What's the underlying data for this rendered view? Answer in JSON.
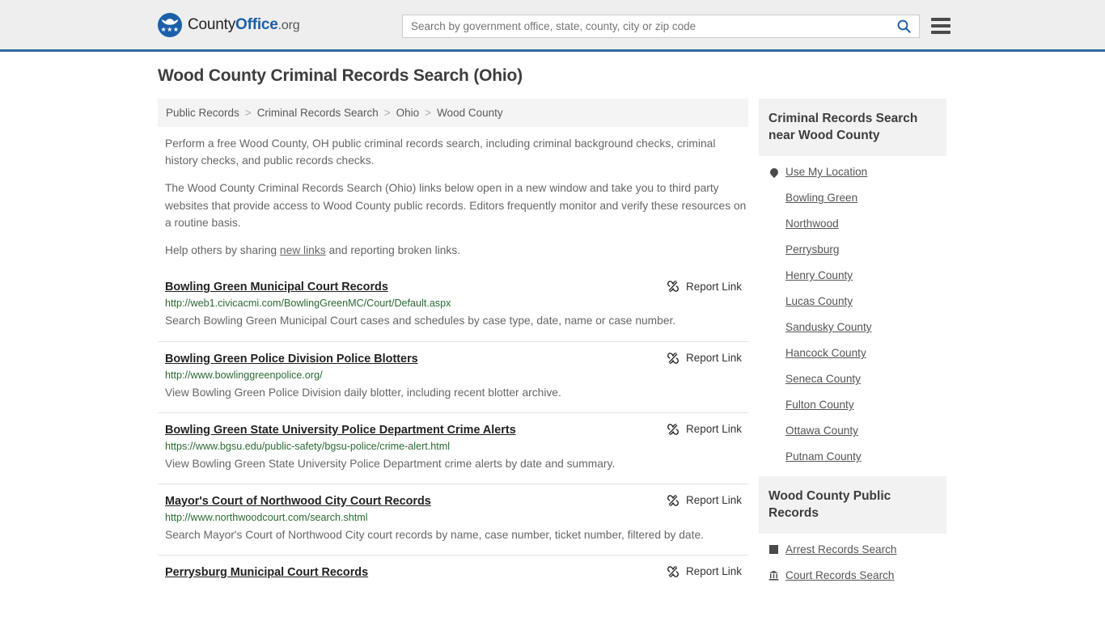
{
  "header": {
    "logo": {
      "prefix": "County",
      "bold": "Office",
      "tld": ".org",
      "badge_icon": "eagle-shield-icon"
    },
    "search": {
      "placeholder": "Search by government office, state, county, city or zip code",
      "value": "",
      "button_icon": "search-icon"
    },
    "menu_icon": "hamburger-menu-icon"
  },
  "page": {
    "title": "Wood County Criminal Records Search (Ohio)"
  },
  "breadcrumb": {
    "separator": ">",
    "items": [
      {
        "label": "Public Records",
        "current": false
      },
      {
        "label": "Criminal Records Search",
        "current": false
      },
      {
        "label": "Ohio",
        "current": false
      },
      {
        "label": "Wood County",
        "current": true
      }
    ]
  },
  "intro": {
    "p1": "Perform a free Wood County, OH public criminal records search, including criminal background checks, criminal history checks, and public records checks.",
    "p2": "The Wood County Criminal Records Search (Ohio) links below open in a new window and take you to third party websites that provide access to Wood County public records. Editors frequently monitor and verify these resources on a routine basis.",
    "p3_before": "Help others by sharing ",
    "p3_link": "new links",
    "p3_after": " and reporting broken links."
  },
  "report_link": {
    "label": "Report Link",
    "icon": "broken-link-icon"
  },
  "results": [
    {
      "title": "Bowling Green Municipal Court Records",
      "url": "http://web1.civicacmi.com/BowlingGreenMC/Court/Default.aspx",
      "description": "Search Bowling Green Municipal Court cases and schedules by case type, date, name or case number."
    },
    {
      "title": "Bowling Green Police Division Police Blotters",
      "url": "http://www.bowlinggreenpolice.org/",
      "description": "View Bowling Green Police Division daily blotter, including recent blotter archive."
    },
    {
      "title": "Bowling Green State University Police Department Crime Alerts",
      "url": "https://www.bgsu.edu/public-safety/bgsu-police/crime-alert.html",
      "description": "View Bowling Green State University Police Department crime alerts by date and summary."
    },
    {
      "title": "Mayor's Court of Northwood City Court Records",
      "url": "http://www.northwoodcourt.com/search.shtml",
      "description": "Search Mayor's Court of Northwood City court records by name, case number, ticket number, filtered by date."
    },
    {
      "title": "Perrysburg Municipal Court Records",
      "url": "",
      "description": ""
    }
  ],
  "sidebar": {
    "nearby": {
      "heading": "Criminal Records Search near Wood County",
      "items": [
        {
          "label": "Use My Location",
          "icon": "location-pin-icon"
        },
        {
          "label": "Bowling Green",
          "icon": ""
        },
        {
          "label": "Northwood",
          "icon": ""
        },
        {
          "label": "Perrysburg",
          "icon": ""
        },
        {
          "label": "Henry County",
          "icon": ""
        },
        {
          "label": "Lucas County",
          "icon": ""
        },
        {
          "label": "Sandusky County",
          "icon": ""
        },
        {
          "label": "Hancock County",
          "icon": ""
        },
        {
          "label": "Seneca County",
          "icon": ""
        },
        {
          "label": "Fulton County",
          "icon": ""
        },
        {
          "label": "Ottawa County",
          "icon": ""
        },
        {
          "label": "Putnam County",
          "icon": ""
        }
      ]
    },
    "public_records": {
      "heading": "Wood County Public Records",
      "items": [
        {
          "label": "Arrest Records Search",
          "icon": "square-badge-icon"
        },
        {
          "label": "Court Records Search",
          "icon": "courthouse-icon"
        }
      ]
    }
  },
  "colors": {
    "header_bg": "#eeeeee",
    "header_border": "#31699f",
    "brand_blue": "#1b5faa",
    "url_green": "#2a6b33",
    "panel_gray": "#f2f2f2",
    "text_gray": "#666666"
  }
}
